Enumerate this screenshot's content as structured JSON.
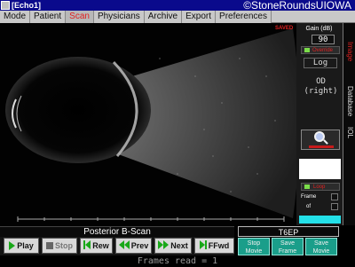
{
  "window": {
    "title": "[Echo1]",
    "credit": "©StoneRoundsUIOWA"
  },
  "menu": {
    "tabs": [
      {
        "label": "Mode"
      },
      {
        "label": "Patient"
      },
      {
        "label": "Scan"
      },
      {
        "label": "Physicians"
      },
      {
        "label": "Archive"
      },
      {
        "label": "Export"
      },
      {
        "label": "Preferences"
      }
    ],
    "active_tab": "Scan"
  },
  "viewer": {
    "saved_label": "SAVED",
    "scan_label": "Posterior B-Scan",
    "probe_label": "T6EP"
  },
  "right_panel": {
    "gain_label": "Gain (dB)",
    "gain_value": "90",
    "override_label": "Override",
    "scale_value": "Log",
    "eye_label": "OD\n(right)",
    "loop_label": "Loop",
    "frame_label": "Frame",
    "of_label": "of"
  },
  "side_tabs": [
    {
      "label": "Image",
      "active": true
    },
    {
      "label": "Database",
      "active": false
    },
    {
      "label": "IOL",
      "active": false
    }
  ],
  "controls": {
    "play": "Play",
    "stop": "Stop",
    "rew": "Rew",
    "prev": "Prev",
    "next": "Next",
    "ffwd": "FFwd",
    "stop_movie": "Stop\nMovie",
    "save_frame": "Save\nFrame",
    "save_movie": "Save\nMovie"
  },
  "status": {
    "text": "Frames read = 1"
  },
  "colors": {
    "accent_red": "#e02020",
    "button_teal": "#1a9e8a",
    "led_green": "#7bdc4a",
    "cyan_bar": "#23e0e8"
  }
}
